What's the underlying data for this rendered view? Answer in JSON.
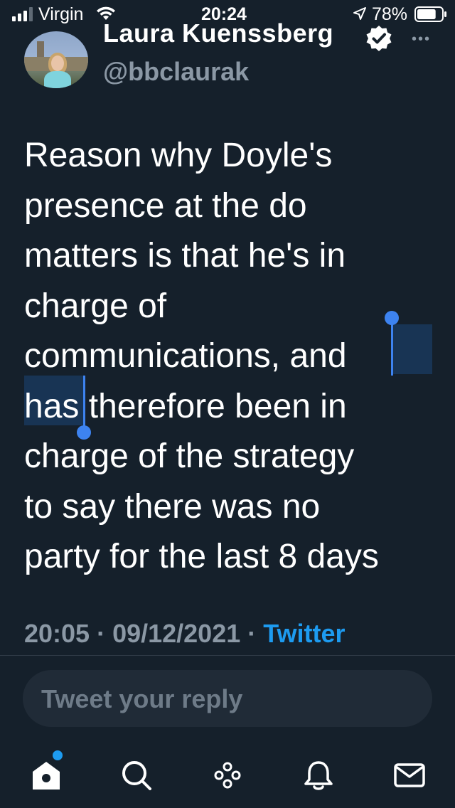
{
  "status_bar": {
    "carrier": "Virgin",
    "time": "20:24",
    "battery_percent": "78%",
    "battery_level": 0.78
  },
  "tweet": {
    "author": {
      "display_name": "Laura Kuenssberg",
      "handle": "@bbclaurak",
      "verified": true
    },
    "lines": [
      "Reason why Doyle's",
      "presence at the do",
      "matters is that he's in",
      "charge of",
      "communications, and",
      "has therefore been in",
      "charge of the strategy",
      "to say there was no",
      "party for the last 8 days"
    ],
    "timestamp": "20:05 · 09/12/2021 · ",
    "source": "Twitter"
  },
  "reply": {
    "placeholder": "Tweet your reply"
  },
  "tabbar": {
    "items": [
      "home-icon",
      "search-icon",
      "spaces-icon",
      "notifications-icon",
      "messages-icon"
    ],
    "accent": "#1d9bf0"
  },
  "colors": {
    "background": "#15202b",
    "secondary_text": "#8b98a5",
    "link": "#1d9bf0",
    "selection_handle": "#3d83f0"
  }
}
